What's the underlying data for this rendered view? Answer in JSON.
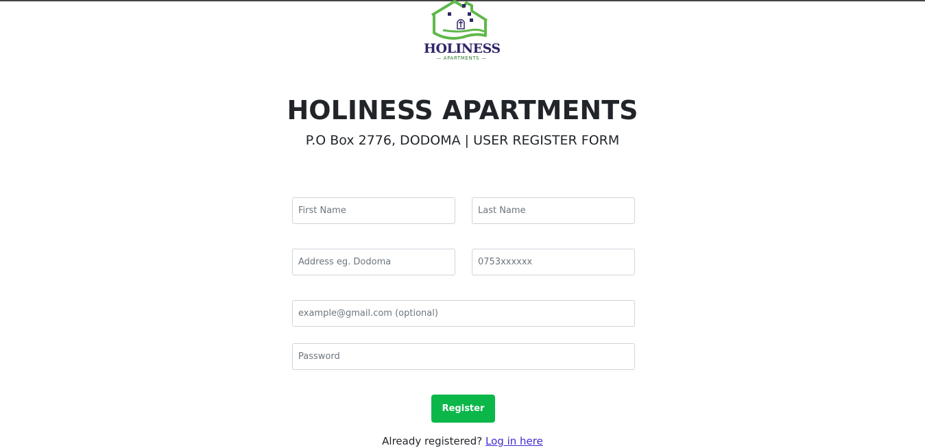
{
  "logo": {
    "brand": "HOLINESS",
    "tagline": "— APARTMENTS —"
  },
  "header": {
    "title": "HOLINESS APARTMENTS",
    "subtitle": "P.O Box 2776, DODOMA | USER REGISTER FORM"
  },
  "form": {
    "first_name_placeholder": "First Name",
    "last_name_placeholder": "Last Name",
    "address_placeholder": "Address eg. Dodoma",
    "phone_placeholder": "0753xxxxxx",
    "email_placeholder": "example@gmail.com (optional)",
    "password_placeholder": "Password",
    "register_label": "Register"
  },
  "footer": {
    "already_text": "Already registered?",
    "login_link": "Log in here"
  },
  "colors": {
    "accent": "#0cb74a",
    "brand_navy": "#2d2668",
    "logo_green": "#5fb84a",
    "link": "#3d2ad1"
  }
}
